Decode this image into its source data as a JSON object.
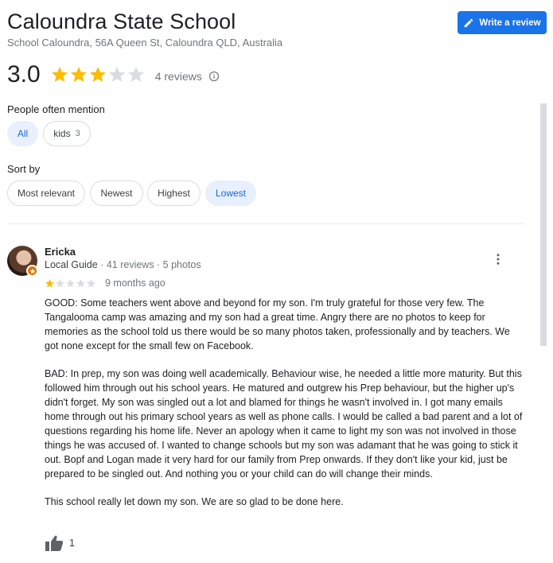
{
  "place": {
    "title": "Caloundra State School",
    "address": "School Caloundra, 56A Queen St, Caloundra QLD, Australia",
    "write_review_label": "Write a review"
  },
  "rating": {
    "average": "3.0",
    "stars_filled": 3,
    "stars_total": 5,
    "count_label": "4 reviews"
  },
  "mentions": {
    "heading": "People often mention",
    "chips": [
      {
        "label": "All",
        "count": "",
        "selected": true
      },
      {
        "label": "kids",
        "count": "3",
        "selected": false
      }
    ]
  },
  "sort": {
    "heading": "Sort by",
    "options": [
      {
        "label": "Most relevant",
        "selected": false
      },
      {
        "label": "Newest",
        "selected": false
      },
      {
        "label": "Highest",
        "selected": false
      },
      {
        "label": "Lowest",
        "selected": true
      }
    ]
  },
  "review": {
    "name": "Ericka",
    "guide_label": "Local Guide",
    "meta": " · 41 reviews · 5 photos",
    "stars": 1,
    "time": "9 months ago",
    "paragraphs": [
      "GOOD: Some teachers went above and beyond for my son. I'm truly grateful for those very few. The Tangalooma camp was amazing and my son had a great time. Angry there are no photos to keep for memories as the school told us there would be so many photos taken, professionally and by teachers. We got none except for the small few on Facebook.",
      "BAD: In prep, my son was doing well academically. Behaviour wise, he needed a little more maturity. But this followed him through out his school years. He matured and outgrew his Prep behaviour, but the higher up's didn't forget. My son was singled out a lot and blamed for things he wasn't involved in. I got many emails home through out his primary school years as well as phone calls. I would be called a bad parent and a lot of questions regarding his home life. Never an apology when it came to light my son was not involved in those things he was accused of. I wanted to change schools but my son was adamant that he was going to stick it out. Bopf and Logan made it very hard for our family from Prep onwards. If they don't like your kid, just be prepared to be singled out. And nothing you or your child can do will change their minds.",
      "This school really let down my son. We are so glad to be done here."
    ],
    "likes": "1"
  },
  "colors": {
    "star_filled": "#fbbc04",
    "star_empty": "#dadce0",
    "accent": "#1a73e8",
    "guide_badge": "#e37400"
  }
}
